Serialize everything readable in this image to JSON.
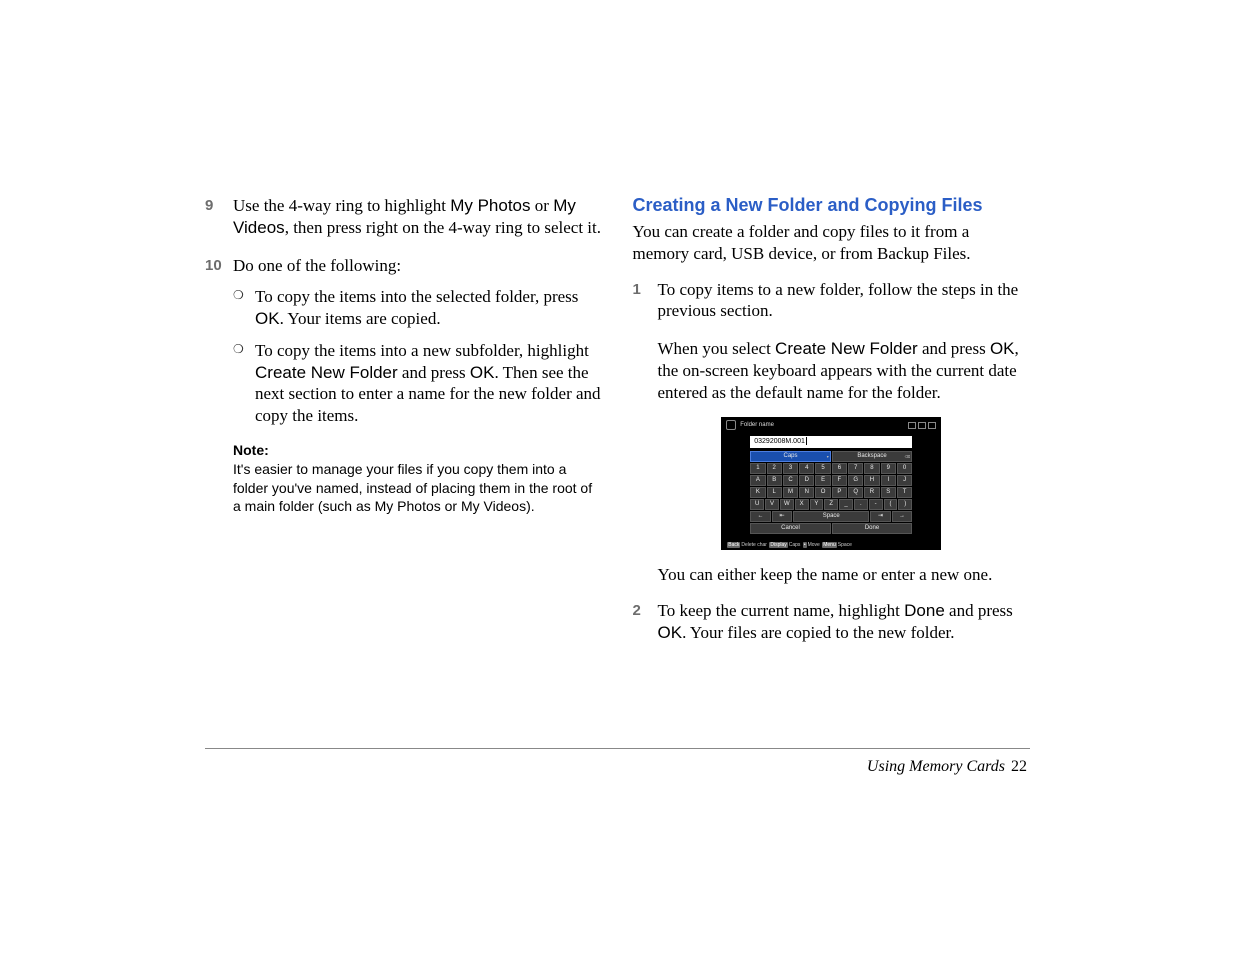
{
  "left": {
    "step9": {
      "num": "9",
      "pre": "Use the 4-way ring to highlight ",
      "bold1": "My Photos",
      "mid": " or ",
      "bold2": "My Videos",
      "post": ", then press right on the 4-way ring to select it."
    },
    "step10": {
      "num": "10",
      "text": "Do one of the following:"
    },
    "bullet1": {
      "pre": "To copy the items into the selected folder, press ",
      "bold": "OK",
      "post": ". Your items are copied."
    },
    "bullet2": {
      "pre": "To copy the items into a new subfolder, highlight ",
      "bold1": "Create New Folder",
      "mid": " and press ",
      "bold2": "OK",
      "post": ". Then see the next section to enter a name for the new folder and copy the items."
    },
    "note": {
      "label": "Note:",
      "text": "It's easier to manage your files if you copy them into a folder you've named, instead of placing them in the root of a main folder (such as My Photos or My Videos)."
    }
  },
  "right": {
    "heading": "Creating a New Folder and Copying Files",
    "intro": "You can create a folder and copy files to it from a memory card, USB device, or from Backup Files.",
    "step1": {
      "num": "1",
      "text": "To copy items to a new folder, follow the steps in the previous section."
    },
    "p2": {
      "pre": "When you select ",
      "bold1": "Create New Folder",
      "mid": " and press ",
      "bold2": "OK",
      "post": ", the on-screen keyboard appears with the current date entered as the default name for the folder."
    },
    "keyboard": {
      "title": "Folder name",
      "input_value": "03292008M.001",
      "caps": "Caps",
      "backspace": "Backspace",
      "row_digits": [
        "1",
        "2",
        "3",
        "4",
        "5",
        "6",
        "7",
        "8",
        "9",
        "0"
      ],
      "row_a": [
        "A",
        "B",
        "C",
        "D",
        "E",
        "F",
        "G",
        "H",
        "I",
        "J"
      ],
      "row_k": [
        "K",
        "L",
        "M",
        "N",
        "O",
        "P",
        "Q",
        "R",
        "S",
        "T"
      ],
      "row_u": [
        "U",
        "V",
        "W",
        "X",
        "Y",
        "Z",
        "_",
        ".",
        "-",
        "(",
        ")"
      ],
      "arrow_left": "←",
      "arrow_ll": "⇤",
      "space": "Space",
      "arrow_rr": "⇥",
      "arrow_right": "→",
      "cancel": "Cancel",
      "done": "Done",
      "hint_delete": "Delete char",
      "hint_caps": "Caps",
      "hint_move": "Move",
      "hint_space": "Space",
      "hint_chip_back": "Back",
      "hint_chip_display": "Display",
      "hint_chip_4way": "•",
      "hint_chip_menu": "Menu"
    },
    "p3": "You can either keep the name or enter a new one.",
    "step2": {
      "num": "2",
      "pre": "To keep the current name, highlight ",
      "bold1": "Done",
      "mid": " and press ",
      "bold2": "OK",
      "post": ". Your files are copied to the new folder."
    }
  },
  "footer": {
    "section": "Using Memory Cards",
    "page": "22"
  }
}
